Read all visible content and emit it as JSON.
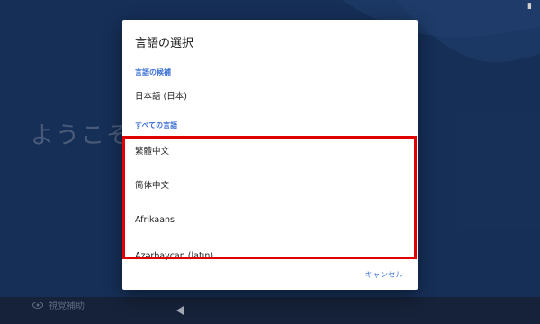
{
  "background": {
    "welcome_text": "ようこそ",
    "accessibility_label": "視覚補助"
  },
  "dialog": {
    "title": "言語の選択",
    "suggested_header": "言語の候補",
    "suggested_items": [
      "日本語 (日本)"
    ],
    "all_header": "すべての言語",
    "all_items": [
      "繁體中文",
      "简体中文",
      "Afrikaans",
      "Azərbaycan (latın)"
    ],
    "cancel_label": "キャンセル"
  },
  "colors": {
    "background": "#1b3a6b",
    "accent": "#3b6fd4",
    "highlight": "#e00000"
  }
}
